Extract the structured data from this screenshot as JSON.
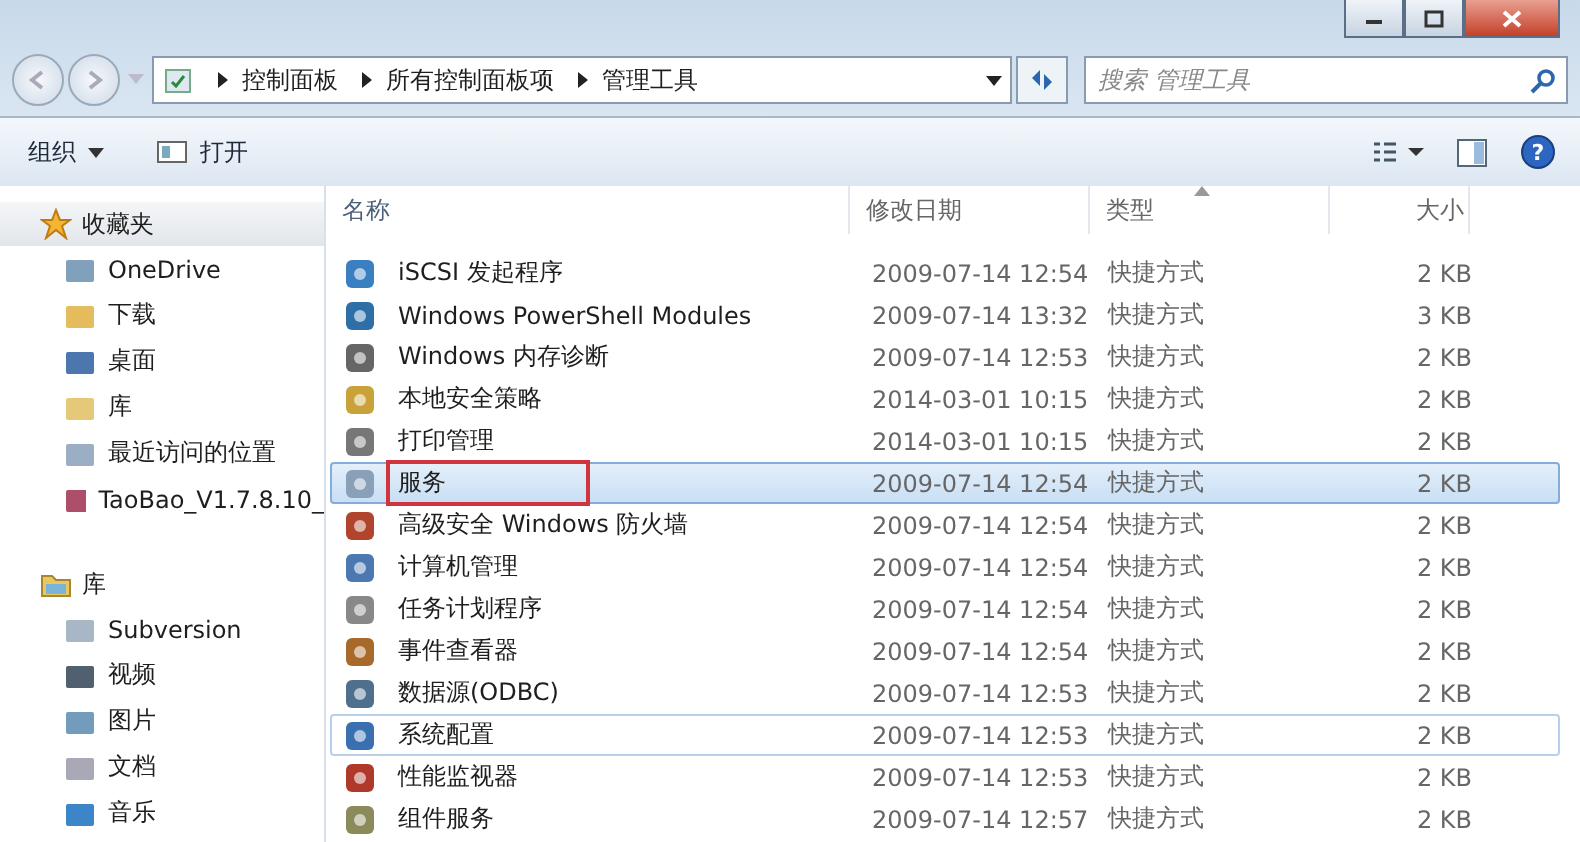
{
  "address_bar": {
    "breadcrumbs": [
      "控制面板",
      "所有控制面板项",
      "管理工具"
    ]
  },
  "search": {
    "placeholder": "搜索 管理工具"
  },
  "toolbar": {
    "help": "?",
    "buttons": [
      {
        "label": "组织",
        "dropdown": true
      },
      {
        "label": "打开",
        "dropdown": false
      }
    ]
  },
  "sidebar": {
    "groups": [
      {
        "label": "收藏夹",
        "selected": true,
        "items": [
          {
            "label": "OneDrive"
          },
          {
            "label": "下载"
          },
          {
            "label": "桌面"
          },
          {
            "label": "库"
          },
          {
            "label": "最近访问的位置"
          },
          {
            "label": "TaoBao_V1.7.8.10_"
          }
        ]
      },
      {
        "label": "库",
        "selected": false,
        "items": [
          {
            "label": "Subversion"
          },
          {
            "label": "视频"
          },
          {
            "label": "图片"
          },
          {
            "label": "文档"
          },
          {
            "label": "音乐"
          }
        ]
      }
    ]
  },
  "table": {
    "columns": [
      {
        "label": "名称",
        "sorted": false
      },
      {
        "label": "修改日期",
        "sorted": false
      },
      {
        "label": "类型",
        "sorted": true
      },
      {
        "label": "大小",
        "sorted": false
      }
    ],
    "rows": [
      {
        "name": "iSCSI 发起程序",
        "date": "2009-07-14 12:54",
        "type": "快捷方式",
        "size": "2 KB",
        "selected": false,
        "hovered": false,
        "marked": false
      },
      {
        "name": "Windows PowerShell Modules",
        "date": "2009-07-14 13:32",
        "type": "快捷方式",
        "size": "3 KB",
        "selected": false,
        "hovered": false,
        "marked": false
      },
      {
        "name": "Windows 内存诊断",
        "date": "2009-07-14 12:53",
        "type": "快捷方式",
        "size": "2 KB",
        "selected": false,
        "hovered": false,
        "marked": false
      },
      {
        "name": "本地安全策略",
        "date": "2014-03-01 10:15",
        "type": "快捷方式",
        "size": "2 KB",
        "selected": false,
        "hovered": false,
        "marked": false
      },
      {
        "name": "打印管理",
        "date": "2014-03-01 10:15",
        "type": "快捷方式",
        "size": "2 KB",
        "selected": false,
        "hovered": false,
        "marked": false
      },
      {
        "name": "服务",
        "date": "2009-07-14 12:54",
        "type": "快捷方式",
        "size": "2 KB",
        "selected": true,
        "hovered": false,
        "marked": true
      },
      {
        "name": "高级安全 Windows 防火墙",
        "date": "2009-07-14 12:54",
        "type": "快捷方式",
        "size": "2 KB",
        "selected": false,
        "hovered": false,
        "marked": false
      },
      {
        "name": "计算机管理",
        "date": "2009-07-14 12:54",
        "type": "快捷方式",
        "size": "2 KB",
        "selected": false,
        "hovered": false,
        "marked": false
      },
      {
        "name": "任务计划程序",
        "date": "2009-07-14 12:54",
        "type": "快捷方式",
        "size": "2 KB",
        "selected": false,
        "hovered": false,
        "marked": false
      },
      {
        "name": "事件查看器",
        "date": "2009-07-14 12:54",
        "type": "快捷方式",
        "size": "2 KB",
        "selected": false,
        "hovered": false,
        "marked": false
      },
      {
        "name": "数据源(ODBC)",
        "date": "2009-07-14 12:53",
        "type": "快捷方式",
        "size": "2 KB",
        "selected": false,
        "hovered": false,
        "marked": false
      },
      {
        "name": "系统配置",
        "date": "2009-07-14 12:53",
        "type": "快捷方式",
        "size": "2 KB",
        "selected": false,
        "hovered": true,
        "marked": false
      },
      {
        "name": "性能监视器",
        "date": "2009-07-14 12:53",
        "type": "快捷方式",
        "size": "2 KB",
        "selected": false,
        "hovered": false,
        "marked": false
      },
      {
        "name": "组件服务",
        "date": "2009-07-14 12:57",
        "type": "快捷方式",
        "size": "2 KB",
        "selected": false,
        "hovered": false,
        "marked": false
      }
    ]
  }
}
